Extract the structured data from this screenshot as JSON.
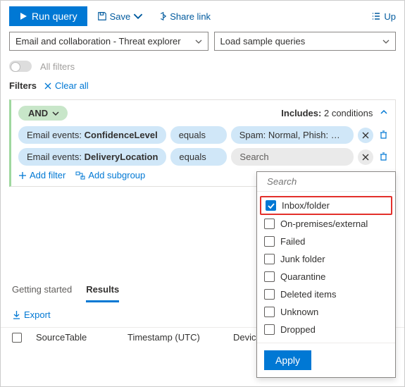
{
  "toolbar": {
    "run_label": "Run query",
    "save_label": "Save",
    "share_label": "Share link",
    "up_label": "Up"
  },
  "selectors": {
    "scope": "Email and collaboration - Threat explorer",
    "sample": "Load sample queries"
  },
  "filters_toggle_label": "All filters",
  "filters_label": "Filters",
  "clear_label": "Clear all",
  "and_label": "AND",
  "includes_label": "Includes:",
  "includes_count": "2 conditions",
  "conditions": [
    {
      "field_prefix": "Email events: ",
      "field": "ConfidenceLevel",
      "op": "equals",
      "val": "Spam: Normal, Phish: High"
    },
    {
      "field_prefix": "Email events: ",
      "field": "DeliveryLocation",
      "op": "equals",
      "val_placeholder": "Search"
    }
  ],
  "add_filter_label": "Add filter",
  "add_subgroup_label": "Add subgroup",
  "tabs": {
    "getting_started": "Getting started",
    "results": "Results"
  },
  "export_label": "Export",
  "table_headers": {
    "source": "SourceTable",
    "timestamp": "Timestamp (UTC)",
    "device": "DeviceId"
  },
  "dropdown": {
    "search_placeholder": "Search",
    "options": [
      {
        "label": "Inbox/folder",
        "checked": true,
        "highlight": true
      },
      {
        "label": "On-premises/external",
        "checked": false
      },
      {
        "label": "Failed",
        "checked": false
      },
      {
        "label": "Junk folder",
        "checked": false
      },
      {
        "label": "Quarantine",
        "checked": false
      },
      {
        "label": "Deleted items",
        "checked": false
      },
      {
        "label": "Unknown",
        "checked": false
      },
      {
        "label": "Dropped",
        "checked": false
      }
    ],
    "apply_label": "Apply"
  }
}
